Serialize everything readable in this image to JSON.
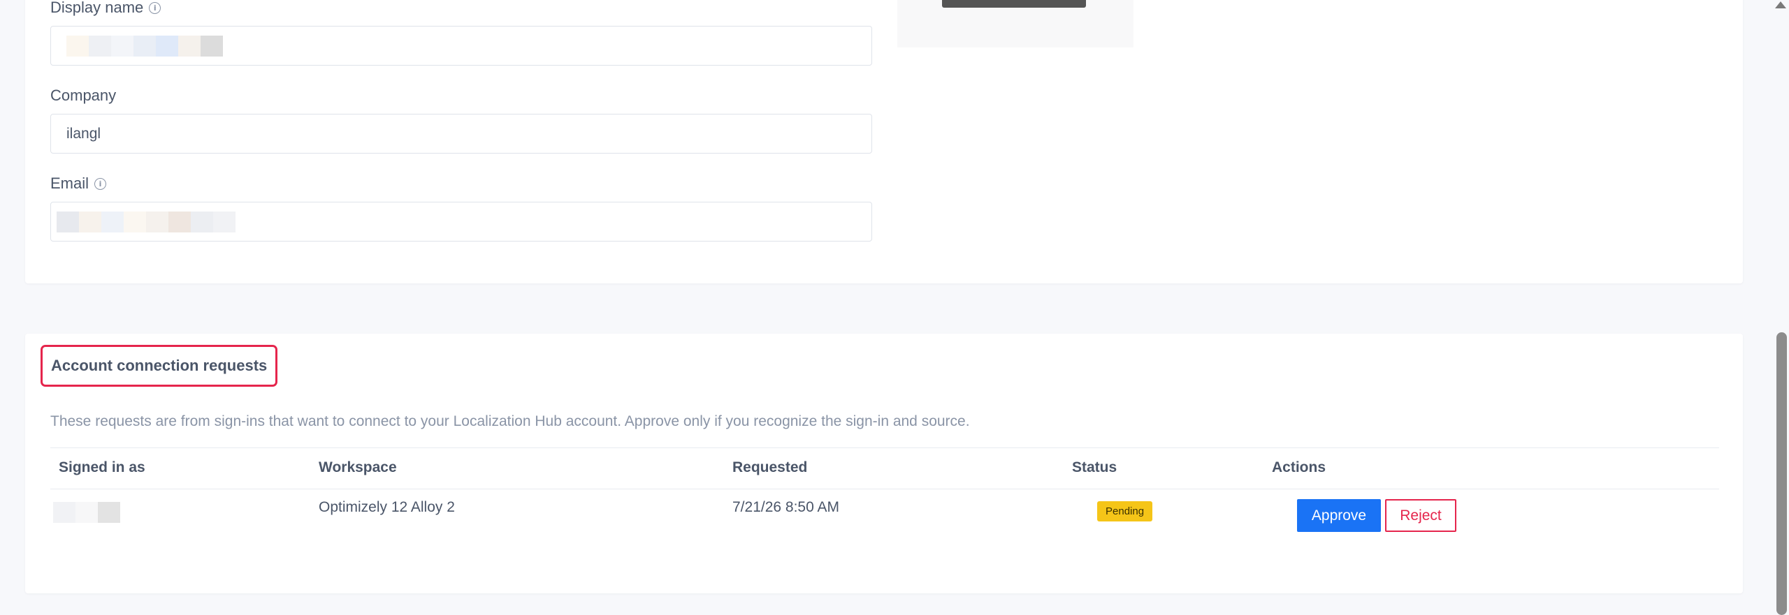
{
  "profile": {
    "display_name_label": "Display name",
    "company_label": "Company",
    "company_value": "ilangl",
    "email_label": "Email"
  },
  "requests": {
    "title": "Account connection requests",
    "description": "These requests are from sign-ins that want to connect to your Localization Hub account. Approve only if you recognize the sign-in and source.",
    "columns": [
      "Signed in as",
      "Workspace",
      "Requested",
      "Status",
      "Actions"
    ],
    "rows": [
      {
        "workspace": "Optimizely 12 Alloy 2",
        "requested": "7/21/26 8:50 AM",
        "status": "Pending",
        "approve_label": "Approve",
        "reject_label": "Reject"
      }
    ]
  },
  "colors": {
    "highlight": "#e5254c",
    "primary": "#1a73f5",
    "pending": "#f5c518"
  },
  "icons": [
    "info-icon",
    "scroll-up-arrow-icon"
  ]
}
